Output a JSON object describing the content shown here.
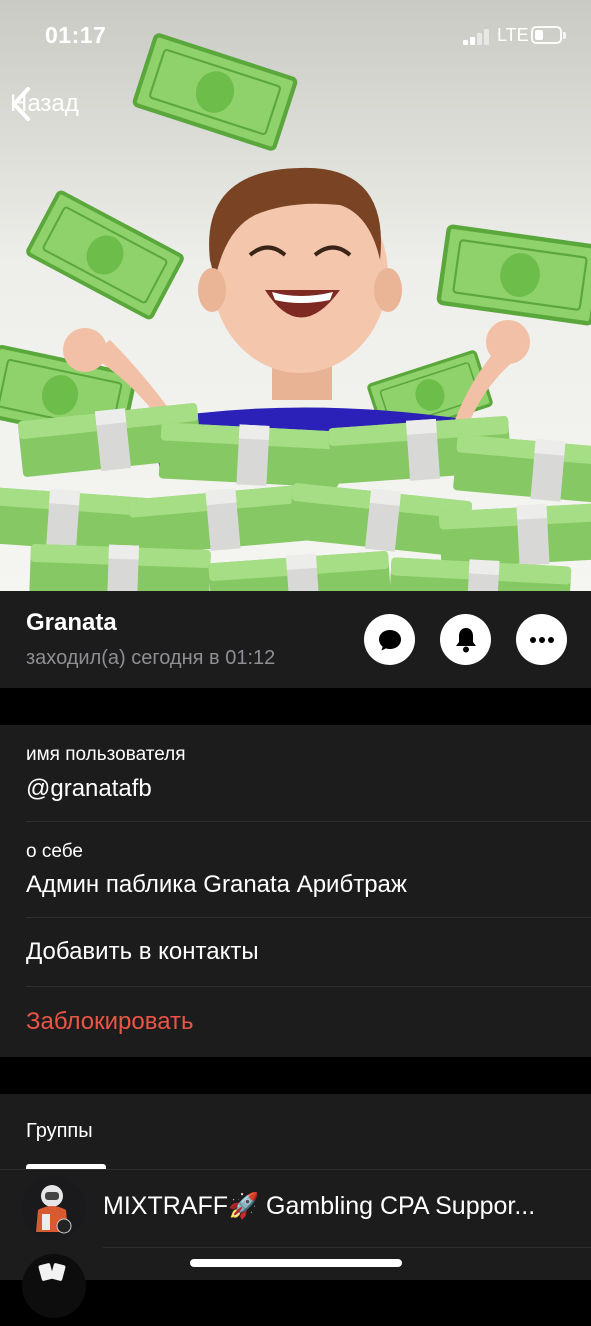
{
  "status_bar": {
    "time": "01:17",
    "network": "LTE",
    "battery_icon": "battery-low-icon",
    "signal_icon": "signal-bars-icon"
  },
  "nav": {
    "back_label": "Назад",
    "back_icon": "chevron-left-icon"
  },
  "hero": {
    "description_icon": "memoji-money-rain-image"
  },
  "profile": {
    "name": "Granata",
    "last_seen": "заходил(а) сегодня в 01:12",
    "actions": [
      {
        "icon": "message-bubble-icon"
      },
      {
        "icon": "bell-icon"
      },
      {
        "icon": "more-dots-icon"
      }
    ]
  },
  "info": {
    "username_label": "имя пользователя",
    "username_value": "@granatafb",
    "bio_label": "о себе",
    "bio_value": "Админ паблика Granata Арибтраж",
    "add_contact": "Добавить в контакты",
    "block": "Заблокировать"
  },
  "groups": {
    "title": "Группы",
    "items": [
      {
        "name": "MIXTRAFF🚀 Gambling CPA Suppor..."
      },
      {
        "name": ""
      }
    ]
  },
  "colors": {
    "accent_destructive": "#eb5545",
    "background": "#000000",
    "cell": "#1c1c1d",
    "secondary_text": "#8e8e93"
  }
}
